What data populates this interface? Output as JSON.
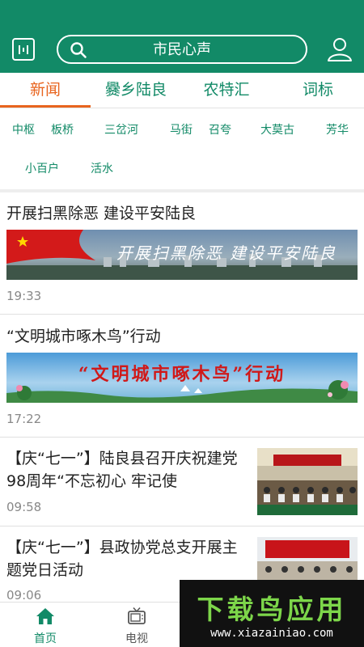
{
  "header": {
    "search_text": "市民心声",
    "menu_icon": "menu-square-icon",
    "search_icon": "search-icon",
    "user_icon": "user-icon",
    "accent_color": "#128a67"
  },
  "tabs": [
    {
      "label": "新闻",
      "active": true
    },
    {
      "label": "爨乡陆良",
      "active": false
    },
    {
      "label": "农特汇",
      "active": false
    },
    {
      "label": "词标",
      "active": false
    }
  ],
  "regions": [
    "中枢",
    "板桥",
    "三岔河",
    "马街",
    "召夸",
    "大莫古",
    "芳华",
    "小百户",
    "活水"
  ],
  "news": [
    {
      "title": "开展扫黑除恶  建设平安陆良",
      "banner_text": "开展扫黑除恶  建设平安陆良",
      "time": "19:33"
    },
    {
      "title": "“文明城市啄木鸟”行动",
      "banner_text": "“文明城市啄木鸟”行动",
      "time": "17:22"
    },
    {
      "title": "【庆“七一”】陆良县召开庆祝建党98周年“不忘初心 牢记使",
      "time": "09:58"
    },
    {
      "title": "【庆“七一”】县政协党总支开展主题党日活动",
      "time": "09:06"
    }
  ],
  "bottom_nav": [
    {
      "label": "首页",
      "icon": "home-icon",
      "active": true
    },
    {
      "label": "电视",
      "icon": "tv-icon",
      "active": false
    }
  ],
  "watermark": {
    "logo": "下载鸟应用",
    "url": "www.xiazainiao.com"
  }
}
